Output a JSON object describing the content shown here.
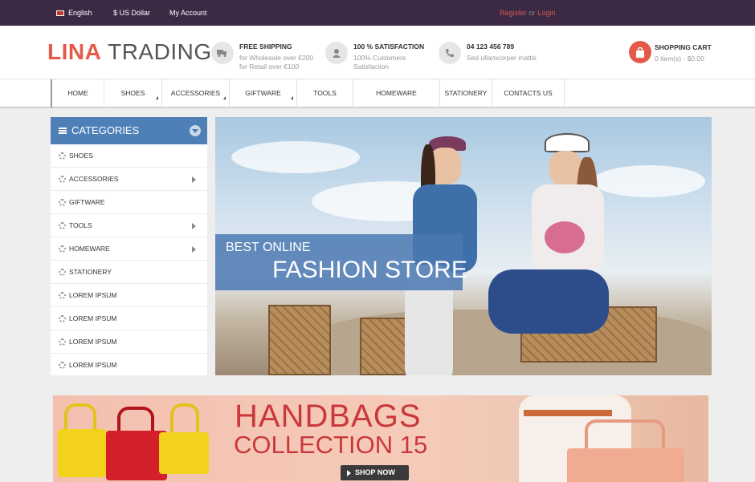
{
  "topbar": {
    "language": "English",
    "currency": "$ US Dollar",
    "account": "My Account",
    "register": "Register",
    "or": "or",
    "login": "Login"
  },
  "header": {
    "logo_part1": "LINA",
    "logo_part2": "TRADING",
    "features": [
      {
        "icon": "truck-icon",
        "title": "FREE SHIPPING",
        "line1": "for Wholesale over €200",
        "line2": "for Retail over €100"
      },
      {
        "icon": "user-icon",
        "title": "100 % SATISFACTION",
        "line1": "100% Customers",
        "line2": "Satisfaction"
      },
      {
        "icon": "phone-icon",
        "title": "04 123 456 789",
        "line1": "Sed ullamcorper mattis",
        "line2": ""
      }
    ],
    "cart": {
      "icon": "shopping-bag-icon",
      "title": "SHOPPING CART",
      "summary": "0 item(s) - $0.00"
    }
  },
  "nav": {
    "items": [
      {
        "label": "HOME",
        "has_submenu": false
      },
      {
        "label": "SHOES",
        "has_submenu": true
      },
      {
        "label": "ACCESSORIES",
        "has_submenu": true
      },
      {
        "label": "GIFTWARE",
        "has_submenu": true
      },
      {
        "label": "TOOLS",
        "has_submenu": false
      },
      {
        "label": "HOMEWARE",
        "has_submenu": false
      },
      {
        "label": "STATIONERY",
        "has_submenu": false
      },
      {
        "label": "CONTACTS US",
        "has_submenu": false
      }
    ]
  },
  "sidebar": {
    "title": "CATEGORIES",
    "items": [
      {
        "label": "SHOES",
        "has_submenu": false
      },
      {
        "label": "ACCESSORIES",
        "has_submenu": true
      },
      {
        "label": "GIFTWARE",
        "has_submenu": false
      },
      {
        "label": "TOOLS",
        "has_submenu": true
      },
      {
        "label": "HOMEWARE",
        "has_submenu": true
      },
      {
        "label": "STATIONERY",
        "has_submenu": false
      },
      {
        "label": "LOREM IPSUM",
        "has_submenu": false
      },
      {
        "label": "LOREM IPSUM",
        "has_submenu": false
      },
      {
        "label": "LOREM IPSUM",
        "has_submenu": false
      },
      {
        "label": "LOREM IPSUM",
        "has_submenu": false
      }
    ]
  },
  "banner": {
    "line1": "BEST ONLINE",
    "line2": "FASHION STORE"
  },
  "promo": {
    "line1": "HANDBAGS",
    "line2": "COLLECTION 15",
    "button": "SHOP NOW"
  },
  "colors": {
    "topbar": "#3c2a45",
    "accent": "#e45a4a",
    "category_header": "#4f7fb7"
  }
}
